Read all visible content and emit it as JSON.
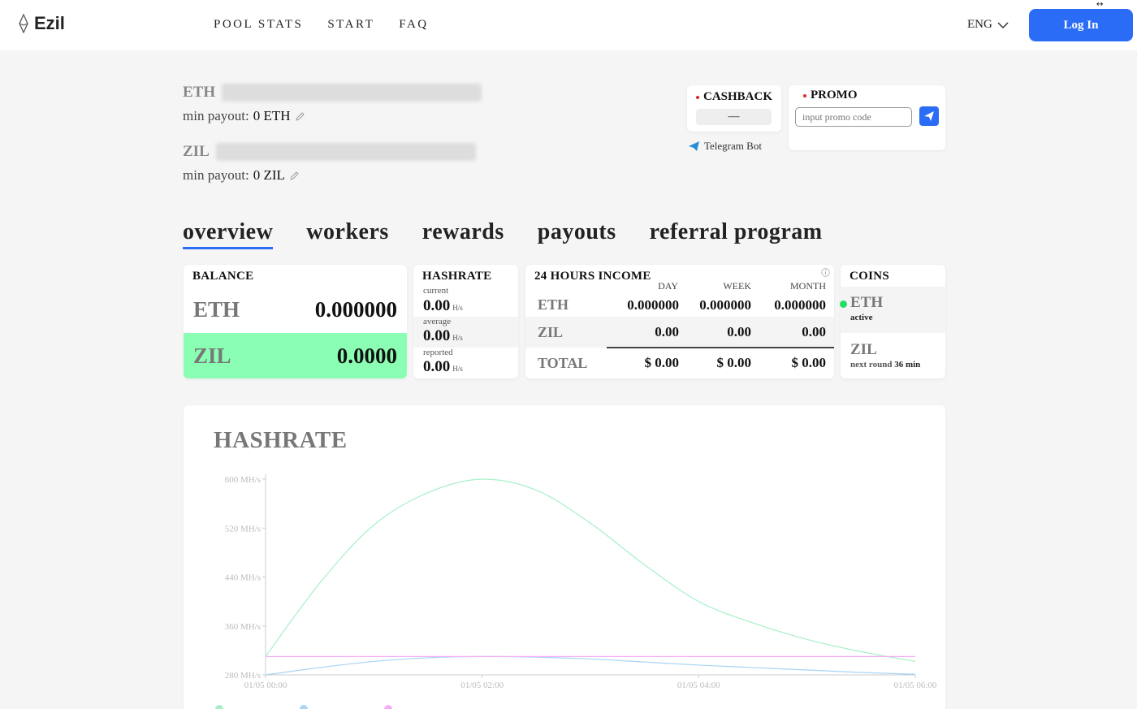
{
  "header": {
    "logo_text": "Ezil",
    "nav": [
      "POOL STATS",
      "START",
      "FAQ"
    ],
    "language": "ENG",
    "login_label": "Log In"
  },
  "wallets": [
    {
      "coin": "ETH",
      "payout_label": "min payout:",
      "payout_value": "0 ETH"
    },
    {
      "coin": "ZIL",
      "payout_label": "min payout:",
      "payout_value": "0 ZIL"
    }
  ],
  "cashback": {
    "title": "CASHBACK",
    "value": "—",
    "telegram_label": "Telegram Bot"
  },
  "promo": {
    "title": "PROMO",
    "placeholder": "input promo code"
  },
  "tabs": [
    "overview",
    "workers",
    "rewards",
    "payouts",
    "referral program"
  ],
  "balance": {
    "title": "BALANCE",
    "rows": [
      {
        "coin": "ETH",
        "value": "0.000000"
      },
      {
        "coin": "ZIL",
        "value": "0.0000"
      }
    ],
    "highlight_color": "#8affb4"
  },
  "hashrate_card": {
    "title": "HASHRATE",
    "rows": [
      {
        "label": "current",
        "value": "0.00",
        "unit": "H/s"
      },
      {
        "label": "average",
        "value": "0.00",
        "unit": "H/s"
      },
      {
        "label": "reported",
        "value": "0.00",
        "unit": "H/s"
      }
    ]
  },
  "income": {
    "title": "24 HOURS INCOME",
    "columns": [
      "DAY",
      "WEEK",
      "MONTH"
    ],
    "info_icon": "info-icon",
    "rows": [
      {
        "coin": "ETH",
        "values": [
          "0.000000",
          "0.000000",
          "0.000000"
        ]
      },
      {
        "coin": "ZIL",
        "values": [
          "0.00",
          "0.00",
          "0.00"
        ]
      },
      {
        "coin": "TOTAL",
        "values": [
          "$ 0.00",
          "$ 0.00",
          "$ 0.00"
        ]
      }
    ]
  },
  "coins": {
    "title": "COINS",
    "items": [
      {
        "name": "ETH",
        "status": "active",
        "status_color": "#22dd66"
      },
      {
        "name": "ZIL",
        "status_label": "next round",
        "status_value": "36 min"
      }
    ]
  },
  "colors": {
    "accent": "#2a6cf5",
    "current_line": "#a6f0c6",
    "average_line": "#a8d4f5",
    "reported_line": "#f5aef5"
  },
  "chart_data": {
    "type": "line",
    "title": "HASHRATE",
    "y_ticks": [
      "600 MH/s",
      "520 MH/s",
      "440 MH/s",
      "360 MH/s",
      "280 MH/s"
    ],
    "x_ticks": [
      "01/05 00:00",
      "01/05 02:00",
      "01/05 04:00",
      "01/05 06:00"
    ],
    "ylim": [
      280,
      600
    ],
    "x_hours": [
      0,
      0.5,
      1,
      1.5,
      2,
      2.5,
      3,
      3.5,
      4,
      4.5,
      5,
      5.5,
      6
    ],
    "series": [
      {
        "key": "current",
        "color": "#a6f0c6",
        "values": [
          310,
          430,
          525,
          578,
          600,
          582,
          528,
          460,
          400,
          365,
          338,
          318,
          302
        ]
      },
      {
        "key": "average",
        "color": "#a8d4f5",
        "values": [
          280,
          292,
          302,
          308,
          310,
          309,
          306,
          301,
          296,
          292,
          288,
          284,
          281
        ]
      },
      {
        "key": "reported",
        "color": "#f5aef5",
        "values": [
          310,
          310,
          310,
          310,
          310,
          310,
          310,
          310,
          310,
          310,
          310,
          310,
          310
        ]
      }
    ],
    "grid": false
  }
}
